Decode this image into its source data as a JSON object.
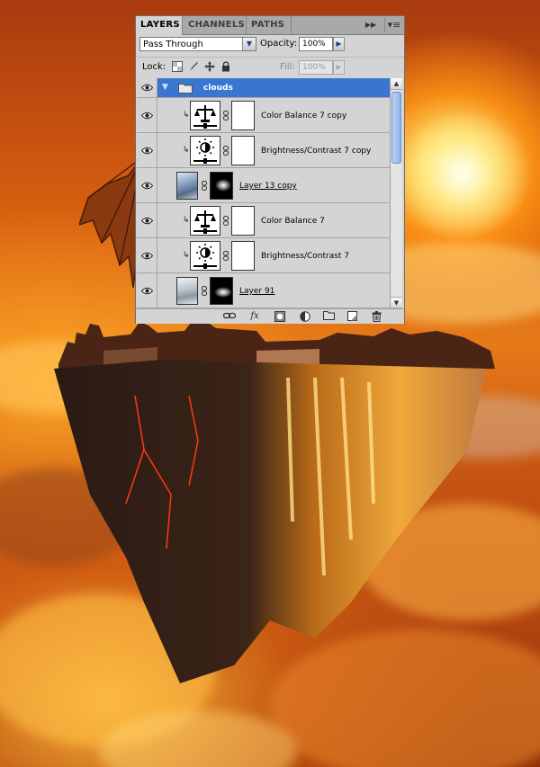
{
  "panel": {
    "tabs": [
      {
        "label": "LAYERS",
        "active": true
      },
      {
        "label": "CHANNELS",
        "active": false
      },
      {
        "label": "PATHS",
        "active": false
      }
    ],
    "collapse_icon": "double-chevron-right-icon",
    "menu_icon": "panel-menu-icon",
    "blend_mode": "Pass Through",
    "opacity_label": "Opacity:",
    "opacity_value": "100%",
    "lock_label": "Lock:",
    "fill_label": "Fill:",
    "fill_value": "100%",
    "selection_color": "#3876d2"
  },
  "layers": [
    {
      "name": "clouds",
      "kind": "group",
      "expanded": true,
      "selected": true,
      "visible": true
    },
    {
      "name": "Color Balance 7 copy",
      "kind": "adjustment",
      "adjustment": "color-balance",
      "clipped": true,
      "visible": true
    },
    {
      "name": "Brightness/Contrast 7 copy",
      "kind": "adjustment",
      "adjustment": "brightness-contrast",
      "clipped": true,
      "visible": true
    },
    {
      "name": "Layer 13 copy",
      "kind": "pixel",
      "has_mask": true,
      "visible": true
    },
    {
      "name": "Color Balance 7",
      "kind": "adjustment",
      "adjustment": "color-balance",
      "clipped": true,
      "visible": true
    },
    {
      "name": "Brightness/Contrast 7",
      "kind": "adjustment",
      "adjustment": "brightness-contrast",
      "clipped": true,
      "visible": true
    },
    {
      "name": "Layer 91",
      "kind": "pixel",
      "has_mask": true,
      "visible": true
    }
  ],
  "footer_buttons": [
    "link-layers-icon",
    "fx-icon",
    "add-mask-icon",
    "adjustment-layer-icon",
    "new-group-icon",
    "new-layer-icon",
    "trash-icon"
  ],
  "footer_fx_label": "fx"
}
